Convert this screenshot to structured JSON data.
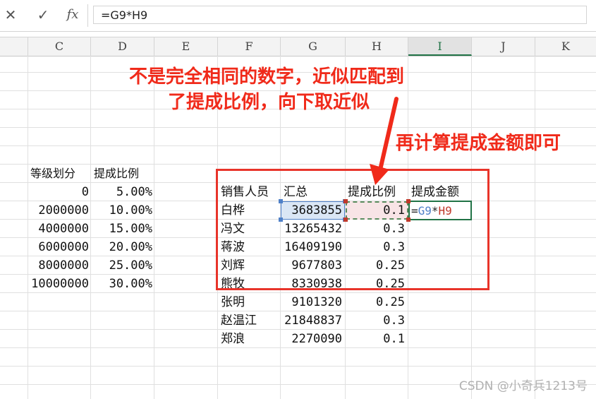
{
  "formula_bar": {
    "cancel_icon": "✕",
    "enter_icon": "✓",
    "fx_label": "fx",
    "formula": "=G9*H9"
  },
  "columns": [
    "C",
    "D",
    "E",
    "F",
    "G",
    "H",
    "I",
    "J",
    "K"
  ],
  "grade_table": {
    "headers": [
      "等级划分",
      "提成比例"
    ],
    "rows": [
      [
        "0",
        "5.00%"
      ],
      [
        "2000000",
        "10.00%"
      ],
      [
        "4000000",
        "15.00%"
      ],
      [
        "6000000",
        "20.00%"
      ],
      [
        "8000000",
        "25.00%"
      ],
      [
        "10000000",
        "30.00%"
      ]
    ]
  },
  "sales_table": {
    "headers": [
      "销售人员",
      "汇总",
      "提成比例",
      "提成金额"
    ],
    "rows": [
      [
        "白桦",
        "3683855",
        "0.1"
      ],
      [
        "冯文",
        "13265432",
        "0.3"
      ],
      [
        "蒋波",
        "16409190",
        "0.3"
      ],
      [
        "刘辉",
        "9677803",
        "0.25"
      ],
      [
        "熊牧",
        "8330938",
        "0.25"
      ],
      [
        "张明",
        "9101320",
        "0.25"
      ],
      [
        "赵温江",
        "21848837",
        "0.3"
      ],
      [
        "郑浪",
        "2270090",
        "0.1"
      ]
    ],
    "editing_formula_parts": [
      "=",
      "G9",
      "*",
      "H9"
    ]
  },
  "annotations": {
    "line1": "不是完全相同的数字，近似匹配到",
    "line2": "了提成比例，向下取近似",
    "line3": "再计算提成金额即可"
  },
  "watermark": "CSDN @小奇兵1213号",
  "colors": {
    "annotation_red": "#f02a1a",
    "ref_blue": "#4f80c8",
    "ref_red": "#c0392b",
    "excel_green": "#217346"
  }
}
